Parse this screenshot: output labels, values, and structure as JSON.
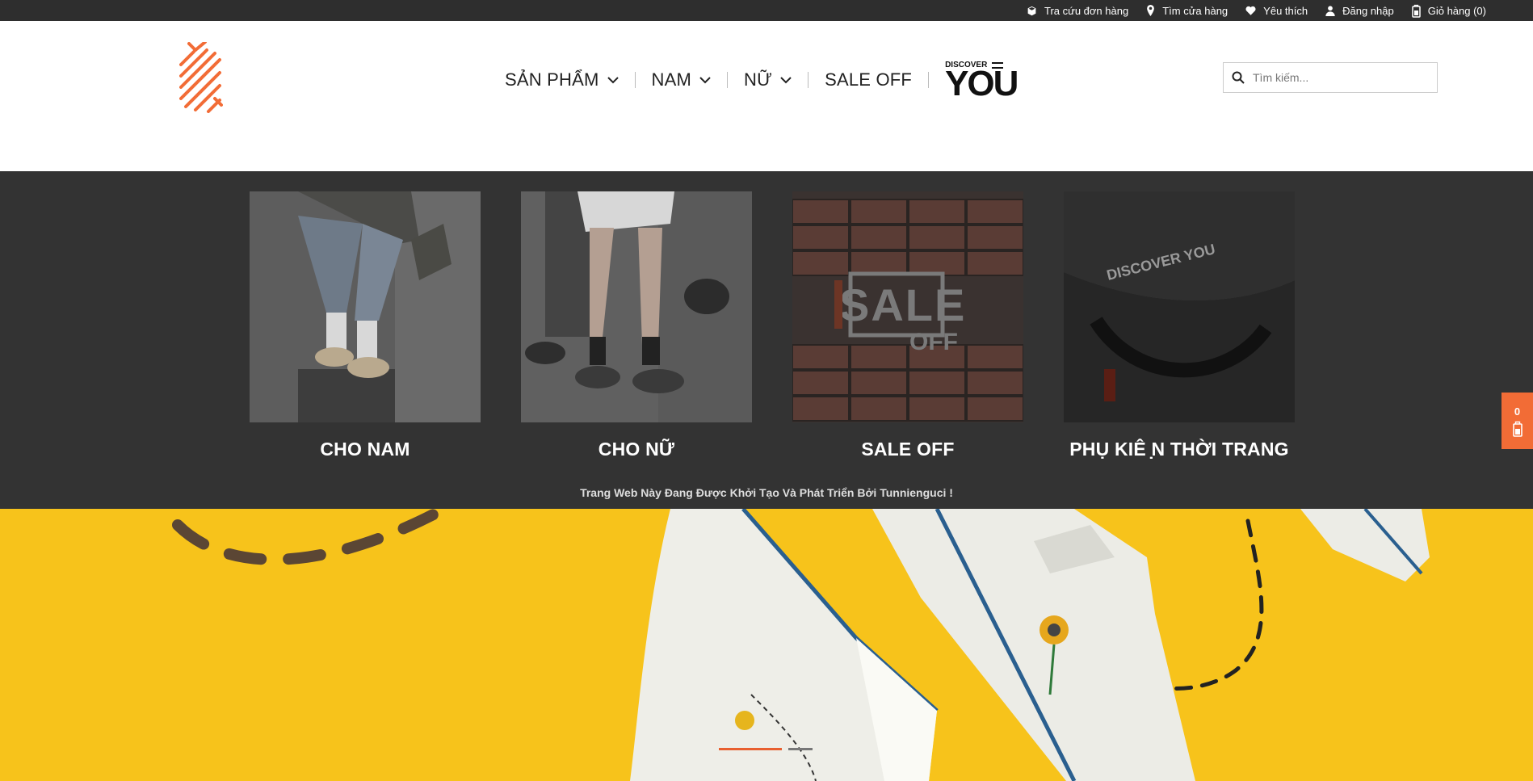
{
  "topbar": {
    "links": [
      {
        "label": "Tra cứu đơn hàng",
        "icon": "box-icon"
      },
      {
        "label": "Tìm cửa hàng",
        "icon": "map-pin-icon"
      },
      {
        "label": "Yêu thích",
        "icon": "heart-icon"
      },
      {
        "label": "Đăng nhập",
        "icon": "user-icon"
      },
      {
        "label": "Giỏ hàng (0)",
        "icon": "cart-icon"
      }
    ]
  },
  "nav": {
    "items": [
      {
        "label": "SẢN PHẨM",
        "has_dropdown": true
      },
      {
        "label": "NAM",
        "has_dropdown": true
      },
      {
        "label": "NỮ",
        "has_dropdown": true
      },
      {
        "label": "SALE OFF",
        "has_dropdown": false
      }
    ],
    "brand": {
      "small": "DISCOVER",
      "big": "YOU"
    }
  },
  "search": {
    "placeholder": "Tìm kiếm..."
  },
  "categories": [
    {
      "label": "CHO NAM"
    },
    {
      "label": "CHO NỮ"
    },
    {
      "label": "SALE OFF",
      "image_text": "SALE",
      "image_subtext": "OFF"
    },
    {
      "label": "PHỤ KIÊ ̣N THỜI TRANG",
      "image_text": "DISCOVER YOU"
    }
  ],
  "footnote": "Trang Web Này Đang Được Khởi Tạo Và Phát Triển Bởi Tunnienguci !",
  "sidecart": {
    "count": "0"
  },
  "hero": {
    "slide_count": 2,
    "active_slide": 1
  },
  "colors": {
    "accent": "#f26c36",
    "topbar": "#2e2e2e",
    "band": "#333333",
    "hero_bg": "#f7c31b"
  }
}
